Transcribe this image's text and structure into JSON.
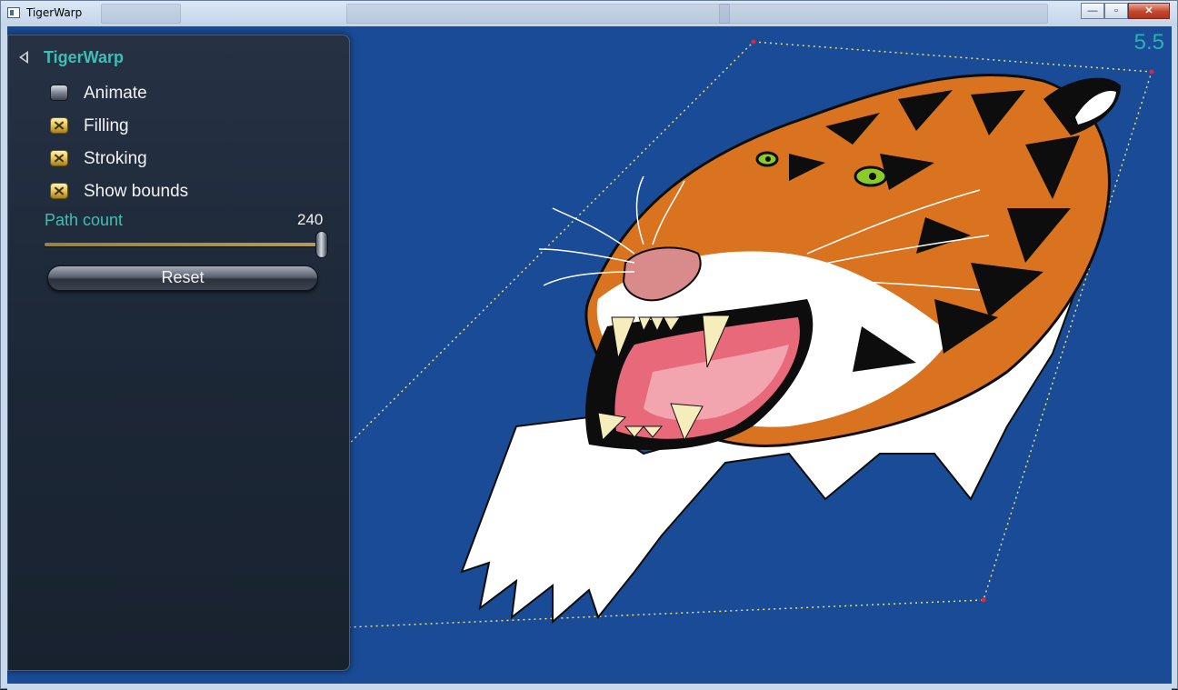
{
  "window": {
    "title": "TigerWarp",
    "controls": {
      "minimize": "—",
      "maximize": "▫",
      "close": "✕"
    }
  },
  "panel": {
    "title": "TigerWarp",
    "checkboxes": [
      {
        "label": "Animate",
        "checked": false
      },
      {
        "label": "Filling",
        "checked": true
      },
      {
        "label": "Stroking",
        "checked": true
      },
      {
        "label": "Show bounds",
        "checked": true
      }
    ],
    "slider": {
      "label": "Path count",
      "value": "240",
      "fraction": 1.0
    },
    "reset_label": "Reset"
  },
  "overlay": {
    "fps": "5.5"
  },
  "colors": {
    "canvas_bg": "#1a4b96",
    "accent_teal": "#3fbfb4",
    "bounds_line": "#f6ec72",
    "corner_point": "#e0243a",
    "tiger_orange": "#d9731f"
  },
  "icons": [
    "app-icon",
    "minimize-icon",
    "maximize-icon",
    "close-icon",
    "back-arrow-icon"
  ]
}
